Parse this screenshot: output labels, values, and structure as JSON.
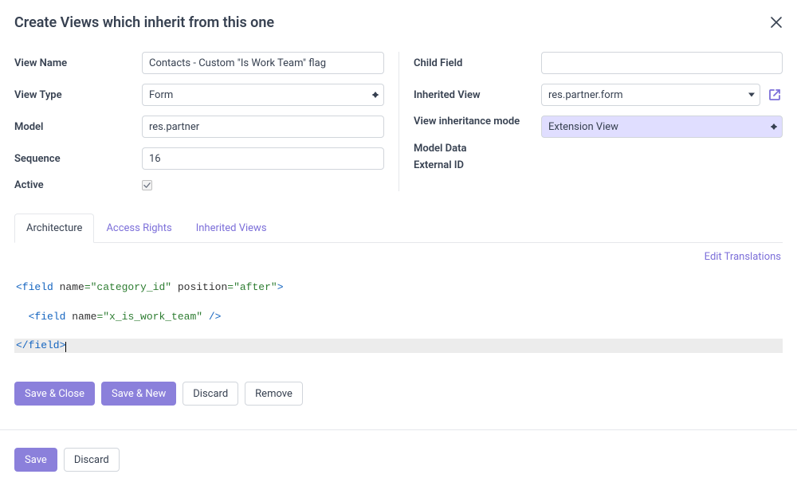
{
  "dialog": {
    "title": "Create Views which inherit from this one"
  },
  "left": {
    "view_name_label": "View Name",
    "view_name_value": "Contacts - Custom \"Is Work Team\" flag",
    "view_type_label": "View Type",
    "view_type_value": "Form",
    "model_label": "Model",
    "model_value": "res.partner",
    "sequence_label": "Sequence",
    "sequence_value": "16",
    "active_label": "Active"
  },
  "right": {
    "child_field_label": "Child Field",
    "child_field_value": "",
    "inherited_view_label": "Inherited View",
    "inherited_view_value": "res.partner.form",
    "inheritance_mode_label": "View inheritance mode",
    "inheritance_mode_value": "Extension View",
    "model_data_label": "Model Data",
    "external_id_label": "External ID"
  },
  "tabs": {
    "architecture": "Architecture",
    "access_rights": "Access Rights",
    "inherited_views": "Inherited Views",
    "edit_translations": "Edit Translations"
  },
  "code": {
    "l1_tag_open": "<field",
    "l1_attr1_name": " name",
    "l1_attr1_val": "=\"category_id\"",
    "l1_attr2_name": " position",
    "l1_attr2_val": "=\"after\"",
    "l1_tag_close": ">",
    "l2_indent": "  ",
    "l2_tag_open": "<field",
    "l2_attr1_name": " name",
    "l2_attr1_val": "=\"x_is_work_team\"",
    "l2_tag_close": " />",
    "l3_tag": "</field>"
  },
  "buttons": {
    "save_close": "Save & Close",
    "save_new": "Save & New",
    "discard": "Discard",
    "remove": "Remove",
    "save": "Save",
    "discard2": "Discard"
  }
}
